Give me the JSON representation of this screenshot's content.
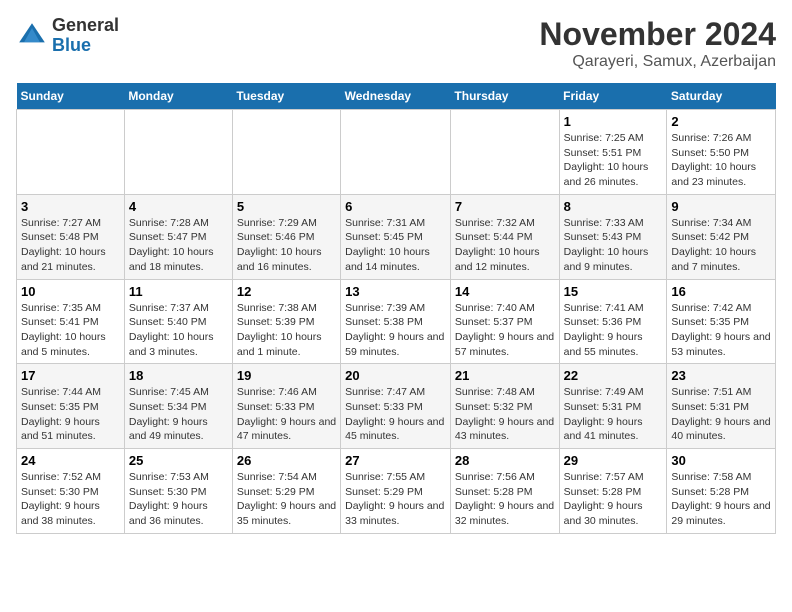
{
  "logo": {
    "general": "General",
    "blue": "Blue"
  },
  "header": {
    "month": "November 2024",
    "location": "Qarayeri, Samux, Azerbaijan"
  },
  "weekdays": [
    "Sunday",
    "Monday",
    "Tuesday",
    "Wednesday",
    "Thursday",
    "Friday",
    "Saturday"
  ],
  "weeks": [
    [
      {
        "day": "",
        "info": ""
      },
      {
        "day": "",
        "info": ""
      },
      {
        "day": "",
        "info": ""
      },
      {
        "day": "",
        "info": ""
      },
      {
        "day": "",
        "info": ""
      },
      {
        "day": "1",
        "info": "Sunrise: 7:25 AM\nSunset: 5:51 PM\nDaylight: 10 hours and 26 minutes."
      },
      {
        "day": "2",
        "info": "Sunrise: 7:26 AM\nSunset: 5:50 PM\nDaylight: 10 hours and 23 minutes."
      }
    ],
    [
      {
        "day": "3",
        "info": "Sunrise: 7:27 AM\nSunset: 5:48 PM\nDaylight: 10 hours and 21 minutes."
      },
      {
        "day": "4",
        "info": "Sunrise: 7:28 AM\nSunset: 5:47 PM\nDaylight: 10 hours and 18 minutes."
      },
      {
        "day": "5",
        "info": "Sunrise: 7:29 AM\nSunset: 5:46 PM\nDaylight: 10 hours and 16 minutes."
      },
      {
        "day": "6",
        "info": "Sunrise: 7:31 AM\nSunset: 5:45 PM\nDaylight: 10 hours and 14 minutes."
      },
      {
        "day": "7",
        "info": "Sunrise: 7:32 AM\nSunset: 5:44 PM\nDaylight: 10 hours and 12 minutes."
      },
      {
        "day": "8",
        "info": "Sunrise: 7:33 AM\nSunset: 5:43 PM\nDaylight: 10 hours and 9 minutes."
      },
      {
        "day": "9",
        "info": "Sunrise: 7:34 AM\nSunset: 5:42 PM\nDaylight: 10 hours and 7 minutes."
      }
    ],
    [
      {
        "day": "10",
        "info": "Sunrise: 7:35 AM\nSunset: 5:41 PM\nDaylight: 10 hours and 5 minutes."
      },
      {
        "day": "11",
        "info": "Sunrise: 7:37 AM\nSunset: 5:40 PM\nDaylight: 10 hours and 3 minutes."
      },
      {
        "day": "12",
        "info": "Sunrise: 7:38 AM\nSunset: 5:39 PM\nDaylight: 10 hours and 1 minute."
      },
      {
        "day": "13",
        "info": "Sunrise: 7:39 AM\nSunset: 5:38 PM\nDaylight: 9 hours and 59 minutes."
      },
      {
        "day": "14",
        "info": "Sunrise: 7:40 AM\nSunset: 5:37 PM\nDaylight: 9 hours and 57 minutes."
      },
      {
        "day": "15",
        "info": "Sunrise: 7:41 AM\nSunset: 5:36 PM\nDaylight: 9 hours and 55 minutes."
      },
      {
        "day": "16",
        "info": "Sunrise: 7:42 AM\nSunset: 5:35 PM\nDaylight: 9 hours and 53 minutes."
      }
    ],
    [
      {
        "day": "17",
        "info": "Sunrise: 7:44 AM\nSunset: 5:35 PM\nDaylight: 9 hours and 51 minutes."
      },
      {
        "day": "18",
        "info": "Sunrise: 7:45 AM\nSunset: 5:34 PM\nDaylight: 9 hours and 49 minutes."
      },
      {
        "day": "19",
        "info": "Sunrise: 7:46 AM\nSunset: 5:33 PM\nDaylight: 9 hours and 47 minutes."
      },
      {
        "day": "20",
        "info": "Sunrise: 7:47 AM\nSunset: 5:33 PM\nDaylight: 9 hours and 45 minutes."
      },
      {
        "day": "21",
        "info": "Sunrise: 7:48 AM\nSunset: 5:32 PM\nDaylight: 9 hours and 43 minutes."
      },
      {
        "day": "22",
        "info": "Sunrise: 7:49 AM\nSunset: 5:31 PM\nDaylight: 9 hours and 41 minutes."
      },
      {
        "day": "23",
        "info": "Sunrise: 7:51 AM\nSunset: 5:31 PM\nDaylight: 9 hours and 40 minutes."
      }
    ],
    [
      {
        "day": "24",
        "info": "Sunrise: 7:52 AM\nSunset: 5:30 PM\nDaylight: 9 hours and 38 minutes."
      },
      {
        "day": "25",
        "info": "Sunrise: 7:53 AM\nSunset: 5:30 PM\nDaylight: 9 hours and 36 minutes."
      },
      {
        "day": "26",
        "info": "Sunrise: 7:54 AM\nSunset: 5:29 PM\nDaylight: 9 hours and 35 minutes."
      },
      {
        "day": "27",
        "info": "Sunrise: 7:55 AM\nSunset: 5:29 PM\nDaylight: 9 hours and 33 minutes."
      },
      {
        "day": "28",
        "info": "Sunrise: 7:56 AM\nSunset: 5:28 PM\nDaylight: 9 hours and 32 minutes."
      },
      {
        "day": "29",
        "info": "Sunrise: 7:57 AM\nSunset: 5:28 PM\nDaylight: 9 hours and 30 minutes."
      },
      {
        "day": "30",
        "info": "Sunrise: 7:58 AM\nSunset: 5:28 PM\nDaylight: 9 hours and 29 minutes."
      }
    ]
  ]
}
